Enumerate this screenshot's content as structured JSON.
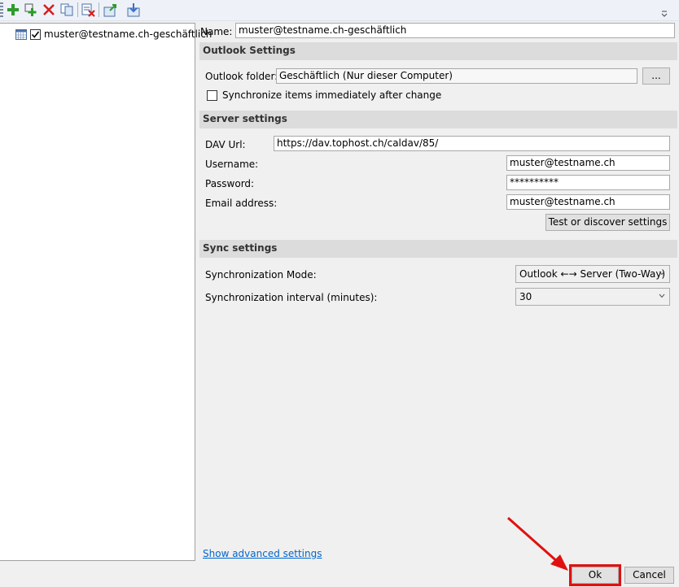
{
  "toolbar": {
    "buttons": [
      {
        "name": "add-profile",
        "icon": "green-plus-icon"
      },
      {
        "name": "add-multiple-profiles",
        "icon": "multi-plus-icon"
      },
      {
        "name": "delete-profile",
        "icon": "red-x-icon"
      },
      {
        "name": "copy-profile",
        "icon": "copy-icon"
      },
      {
        "name": "clear-cache",
        "icon": "clear-cache-icon"
      },
      {
        "name": "export-profiles",
        "icon": "export-icon"
      },
      {
        "name": "import-profiles",
        "icon": "import-icon"
      }
    ],
    "overflow_glyph": "⌄"
  },
  "tree": {
    "items": [
      {
        "label": "muster@testname.ch-geschäftlich",
        "checked": true,
        "icon": "calendar-icon"
      }
    ]
  },
  "profile": {
    "name_label": "Name:",
    "name_value": "muster@testname.ch-geschäftlich"
  },
  "outlook_settings": {
    "header": "Outlook Settings",
    "folder_label": "Outlook folder:",
    "folder_value": "Geschäftlich (Nur dieser Computer)",
    "browse_label": "...",
    "sync_immediately_label": "Synchronize items immediately after change",
    "sync_immediately_checked": false
  },
  "server_settings": {
    "header": "Server settings",
    "dav_url_label": "DAV Url:",
    "dav_url_value": "https://dav.tophost.ch/caldav/85/",
    "username_label": "Username:",
    "username_value": "muster@testname.ch",
    "password_label": "Password:",
    "password_value": "**********",
    "email_label": "Email address:",
    "email_value": "muster@testname.ch",
    "test_button_label": "Test or discover settings"
  },
  "sync_settings": {
    "header": "Sync settings",
    "mode_label": "Synchronization Mode:",
    "mode_value": "Outlook ←→ Server (Two-Way)",
    "interval_label": "Synchronization interval (minutes):",
    "interval_value": "30"
  },
  "footer": {
    "advanced_link": "Show advanced settings",
    "ok_label": "Ok",
    "cancel_label": "Cancel"
  },
  "colors": {
    "highlight": "#e01010",
    "link": "#0066cc",
    "section_header_bg": "#dcdcdc"
  }
}
